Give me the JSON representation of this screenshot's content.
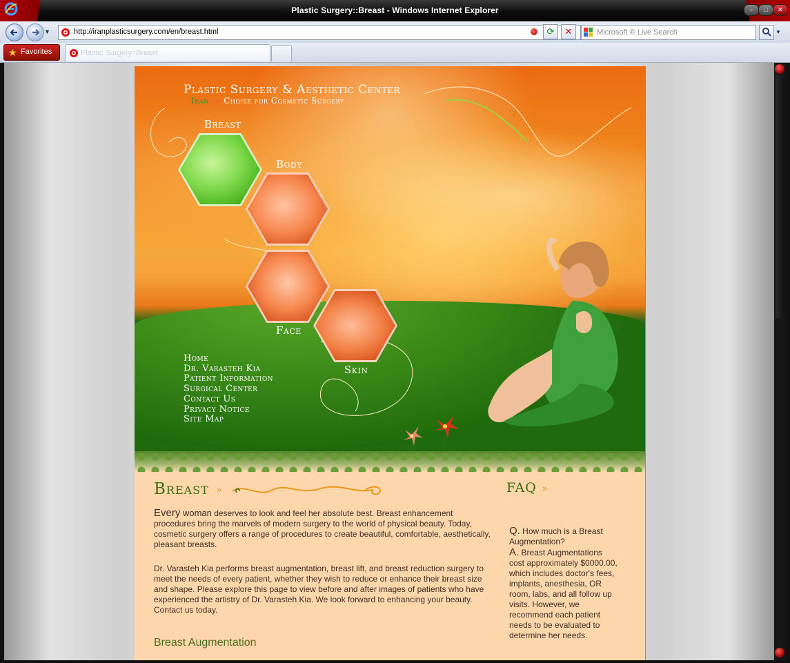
{
  "window": {
    "title": "Plastic Surgery::Breast - Windows Internet Explorer",
    "controls": [
      "minimize",
      "maximize",
      "close"
    ]
  },
  "addressbar": {
    "url": "http://iranplasticsurgery.com/en/breast.html",
    "search_placeholder": "Microsoft ® Live Search"
  },
  "favbar": {
    "favorites_label": "Favorites",
    "tab_title": "Plastic Surgery::Breast"
  },
  "site": {
    "title": "Plastic Surgery & Aesthetic Center",
    "subtitle_ir": "Iran",
    "subtitle_an": "ian",
    "subtitle_rest": " Choise for Cosmetic Surgery",
    "hex_nav": [
      {
        "label": "Breast"
      },
      {
        "label": "Body"
      },
      {
        "label": "Face"
      },
      {
        "label": "Skin"
      }
    ],
    "main_nav": [
      {
        "label": "Home"
      },
      {
        "label": "Dr. Varasteh Kia"
      },
      {
        "label": "Patient Information"
      },
      {
        "label": "Surgical Center"
      },
      {
        "label": "Contact Us"
      },
      {
        "label": "Privacy Notice"
      },
      {
        "label": "Site Map"
      }
    ]
  },
  "content": {
    "section_title": "Breast",
    "p1_lead": "Every",
    "p1_lead2": " woman",
    "p1_rest": " deserves to look and feel her absolute best. Breast enhancement procedures bring the marvels of modern surgery to the world of physical beauty. Today, cosmetic surgery offers a range of procedures to create beautiful, comfortable, aesthetically, pleasant breasts.",
    "p2": "Dr. Varasteh Kia performs breast augmentation, breast lift, and breast reduction surgery to meet the needs of every patient, whether they wish to reduce or enhance their breast size and shape. Please explore this page to view before and after images of patients who have experienced the artistry of Dr. Varasteh Kia. We look forward to enhancing your beauty. Contact us today.",
    "subhead": "Breast Augmentation"
  },
  "faq": {
    "title": "FAQ",
    "q_mark": "Q.",
    "question": " How much is a Breast Augmentation?",
    "a_mark": "A.",
    "answer": " Breast Augmentations cost approximately $0000.00, which includes doctor's fees, implants, anesthesia, OR room, labs, and all follow up visits. However, we recommend each patient needs to be evaluated to determine her needs."
  },
  "colors": {
    "accent_green": "#3b6b12",
    "content_bg": "#fdd6ac",
    "arrow_orange": "#e79a1b"
  }
}
